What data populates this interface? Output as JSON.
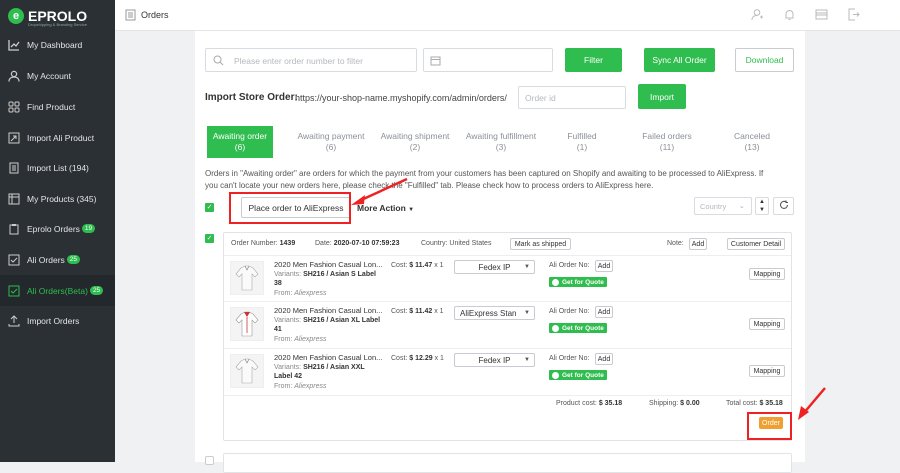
{
  "brand": {
    "name": "EPROLO",
    "tagline": "Dropshipping & Branding Service"
  },
  "sidebar": {
    "items": [
      {
        "label": "My Dashboard",
        "icon": "dashboard-icon"
      },
      {
        "label": "My Account",
        "icon": "user-icon"
      },
      {
        "label": "Find Product",
        "icon": "grid-icon"
      },
      {
        "label": "Import Ali Product",
        "icon": "import-icon"
      },
      {
        "label": "Import List (194)",
        "icon": "list-icon"
      },
      {
        "label": "My Products (345)",
        "icon": "products-icon"
      },
      {
        "label": "Eprolo Orders",
        "badge": "19",
        "icon": "clipboard-icon"
      },
      {
        "label": "Ali Orders",
        "badge": "25",
        "icon": "check-icon"
      },
      {
        "label": "Ali Orders(Beta)",
        "badge": "25",
        "icon": "check-icon"
      },
      {
        "label": "Import Orders",
        "icon": "upload-icon"
      }
    ]
  },
  "topbar": {
    "title": "Orders"
  },
  "filters": {
    "search_placeholder": "Please enter order number to filter",
    "filter_label": "Filter",
    "sync_label": "Sync All Order",
    "download_label": "Download"
  },
  "import": {
    "label": "Import Store Order:",
    "url": "https://your-shop-name.myshopify.com/admin/orders/",
    "placeholder": "Order id",
    "button": "Import"
  },
  "tabs": [
    {
      "label": "Awaiting order",
      "count": "(6)"
    },
    {
      "label": "Awaiting payment",
      "count": "(6)"
    },
    {
      "label": "Awaiting shipment",
      "count": "(2)"
    },
    {
      "label": "Awaiting fulfillment",
      "count": "(3)"
    },
    {
      "label": "Fulfilled",
      "count": "(1)"
    },
    {
      "label": "Failed orders",
      "count": "(11)"
    },
    {
      "label": "Canceled",
      "count": "(13)"
    }
  ],
  "notice": {
    "line1": "Orders in \"Awaiting order\" are orders for which the payment from your customers has been captured on Shopify and awaiting to be processed to AliExpress. If",
    "line2": "you can't locate your new orders here, please check the \"Fulfilled\" tab. Please check how to process orders to AliExpress here."
  },
  "actions": {
    "place_order": "Place order to AliExpress",
    "more": "More Action",
    "country": "Country"
  },
  "order": {
    "number_label": "Order Number:",
    "number": "1439",
    "date_label": "Date:",
    "date": "2020-07-10 07:59:23",
    "country_label": "Country:",
    "country": "United States",
    "mark_shipped": "Mark as shipped",
    "note_label": "Note:",
    "add": "Add",
    "customer_detail": "Customer Detail",
    "cost_label": "Cost:",
    "ali_order_label": "Ali Order No:",
    "quote_label": "Get for Quote",
    "mapping": "Mapping",
    "variants_label": "Variants:",
    "from_label": "From:",
    "items": [
      {
        "title": "2020 Men Fashion Casual Lon...",
        "variant": "SH216 / Asian S Label 38",
        "from": "Aliexpress",
        "cost": "$ 11.47",
        "qty": "x 1",
        "shipping": "Fedex IP"
      },
      {
        "title": "2020 Men Fashion Casual Lon...",
        "variant": "SH216 / Asian XL Label 41",
        "from": "Aliexpress",
        "cost": "$ 11.42",
        "qty": "x 1",
        "shipping": "AliExpress Stan"
      },
      {
        "title": "2020 Men Fashion Casual Lon...",
        "variant": "SH216 / Asian XXL Label 42",
        "from": "Aliexpress",
        "cost": "$ 12.29",
        "qty": "x 1",
        "shipping": "Fedex IP"
      }
    ],
    "product_cost_label": "Product cost:",
    "product_cost": "$ 35.18",
    "shipping_label": "Shipping:",
    "shipping_cost": "$ 0.00",
    "total_label": "Total cost:",
    "total_cost": "$ 35.18",
    "order_button": "Order"
  },
  "colors": {
    "accent": "#2ebd4e",
    "sidebar": "#2b3035",
    "highlight": "#e22222"
  }
}
